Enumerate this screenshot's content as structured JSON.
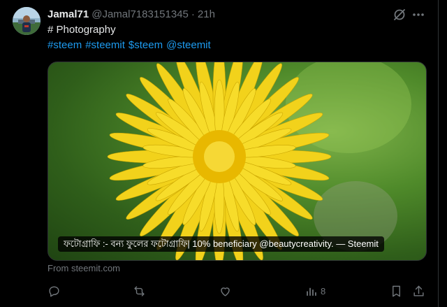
{
  "author": {
    "name": "Jamal71",
    "handle": "@Jamal7183151345",
    "separator": "·",
    "time": "21h"
  },
  "post": {
    "line1": "# Photography",
    "hashtags": [
      "#steem",
      "#steemit",
      "$steem",
      "@steemit"
    ]
  },
  "media": {
    "caption": "ফটোগ্রাফি :- বন্য ফুলের ফটোগ্রাফি| 10% beneficiary @beautycreativity. — Steemit"
  },
  "source": "From steemit.com",
  "actions": {
    "reply_icon": "reply-icon",
    "repost_icon": "repost-icon",
    "like_icon": "like-icon",
    "views_icon": "views-icon",
    "views_count": "8",
    "bookmark_icon": "bookmark-icon",
    "share_icon": "share-icon"
  },
  "colors": {
    "background": "#000000",
    "text": "#e7e9ea",
    "muted": "#71767b",
    "link": "#1d9bf0",
    "flower": "#f2d21b"
  }
}
